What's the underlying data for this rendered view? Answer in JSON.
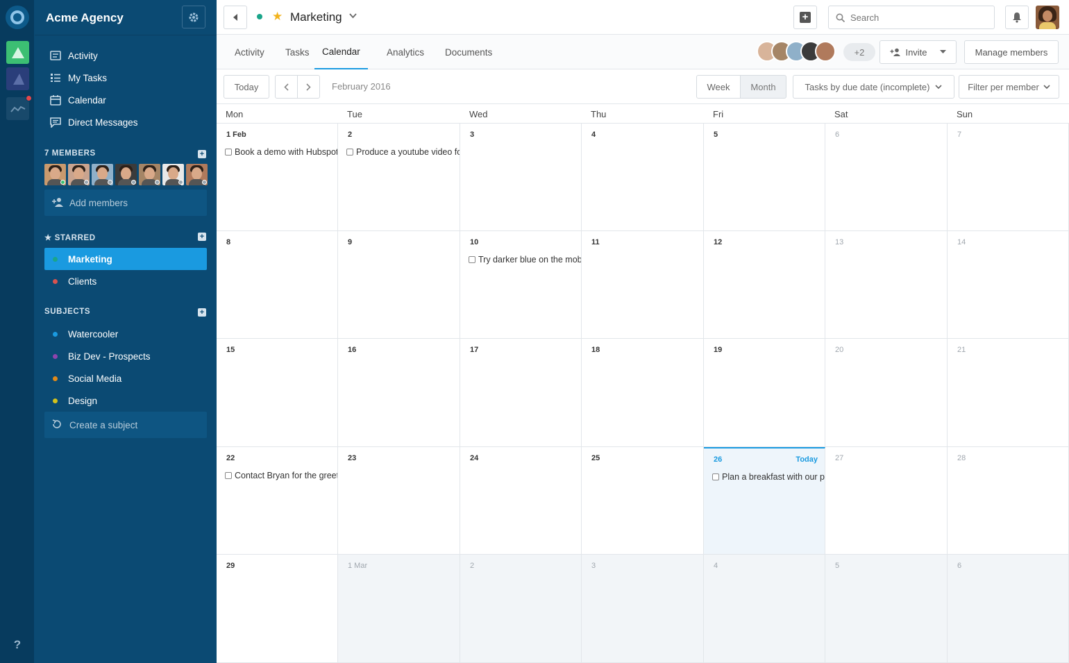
{
  "org": {
    "name": "Acme Agency"
  },
  "nav": [
    {
      "label": "Activity",
      "icon": "activity-icon"
    },
    {
      "label": "My Tasks",
      "icon": "tasks-icon"
    },
    {
      "label": "Calendar",
      "icon": "calendar-icon"
    },
    {
      "label": "Direct Messages",
      "icon": "chat-icon"
    }
  ],
  "members": {
    "title": "7 MEMBERS",
    "add_label": "Add members",
    "avatars": [
      {
        "status": "online",
        "bg": "#c99a6e"
      },
      {
        "status": "offline",
        "bg": "#c9a48f"
      },
      {
        "status": "offline",
        "bg": "#8fb0c9"
      },
      {
        "status": "offline",
        "bg": "#3b3b3b"
      },
      {
        "status": "offline",
        "bg": "#a58566"
      },
      {
        "status": "offline",
        "bg": "#e9e9e9"
      },
      {
        "status": "offline",
        "bg": "#b07a5c"
      }
    ]
  },
  "starred": {
    "title": "STARRED",
    "items": [
      {
        "label": "Marketing",
        "color": "#1aa58a",
        "active": true
      },
      {
        "label": "Clients",
        "color": "#d9534f",
        "active": false
      }
    ]
  },
  "subjects": {
    "title": "SUBJECTS",
    "items": [
      {
        "label": "Watercooler",
        "color": "#1a9ae0"
      },
      {
        "label": "Biz Dev - Prospects",
        "color": "#8e44ad"
      },
      {
        "label": "Social Media",
        "color": "#e08a1a"
      },
      {
        "label": "Design",
        "color": "#d4c21c"
      }
    ],
    "create_label": "Create a subject"
  },
  "rail": {
    "help": "?"
  },
  "header": {
    "title": "Marketing",
    "search_placeholder": "Search"
  },
  "tabs": [
    {
      "label": "Activity",
      "active": false
    },
    {
      "label": "Tasks",
      "active": false
    },
    {
      "label": "Calendar",
      "active": true
    },
    {
      "label": "Analytics",
      "active": false
    },
    {
      "label": "Documents",
      "active": false
    }
  ],
  "team": {
    "more": "+2",
    "invite": "Invite",
    "manage": "Manage members"
  },
  "toolbar": {
    "today": "Today",
    "month_label": "February 2016",
    "week": "Week",
    "month": "Month",
    "sort": "Tasks by due date (incomplete)",
    "filter": "Filter per member"
  },
  "calendar": {
    "weekdays": [
      "Mon",
      "Tue",
      "Wed",
      "Thu",
      "Fri",
      "Sat",
      "Sun"
    ],
    "today_label": "Today",
    "weeks": [
      [
        {
          "d": "1 Feb",
          "task": "Book a demo with Hubspot"
        },
        {
          "d": "2",
          "task": "Produce a youtube video for"
        },
        {
          "d": "3"
        },
        {
          "d": "4"
        },
        {
          "d": "5"
        },
        {
          "d": "6",
          "weekend": true
        },
        {
          "d": "7",
          "weekend": true
        }
      ],
      [
        {
          "d": "8"
        },
        {
          "d": "9"
        },
        {
          "d": "10",
          "task": "Try darker blue on the mobil"
        },
        {
          "d": "11"
        },
        {
          "d": "12"
        },
        {
          "d": "13",
          "weekend": true
        },
        {
          "d": "14",
          "weekend": true
        }
      ],
      [
        {
          "d": "15"
        },
        {
          "d": "16"
        },
        {
          "d": "17"
        },
        {
          "d": "18"
        },
        {
          "d": "19"
        },
        {
          "d": "20",
          "weekend": true
        },
        {
          "d": "21",
          "weekend": true
        }
      ],
      [
        {
          "d": "22",
          "task": "Contact Bryan for the greetin"
        },
        {
          "d": "23"
        },
        {
          "d": "24"
        },
        {
          "d": "25"
        },
        {
          "d": "26",
          "today": true,
          "task": "Plan a breakfast with our pa"
        },
        {
          "d": "27",
          "weekend": true
        },
        {
          "d": "28",
          "weekend": true
        }
      ],
      [
        {
          "d": "29"
        },
        {
          "d": "1 Mar",
          "other": true
        },
        {
          "d": "2",
          "other": true
        },
        {
          "d": "3",
          "other": true
        },
        {
          "d": "4",
          "other": true
        },
        {
          "d": "5",
          "other": true
        },
        {
          "d": "6",
          "other": true
        }
      ]
    ]
  }
}
